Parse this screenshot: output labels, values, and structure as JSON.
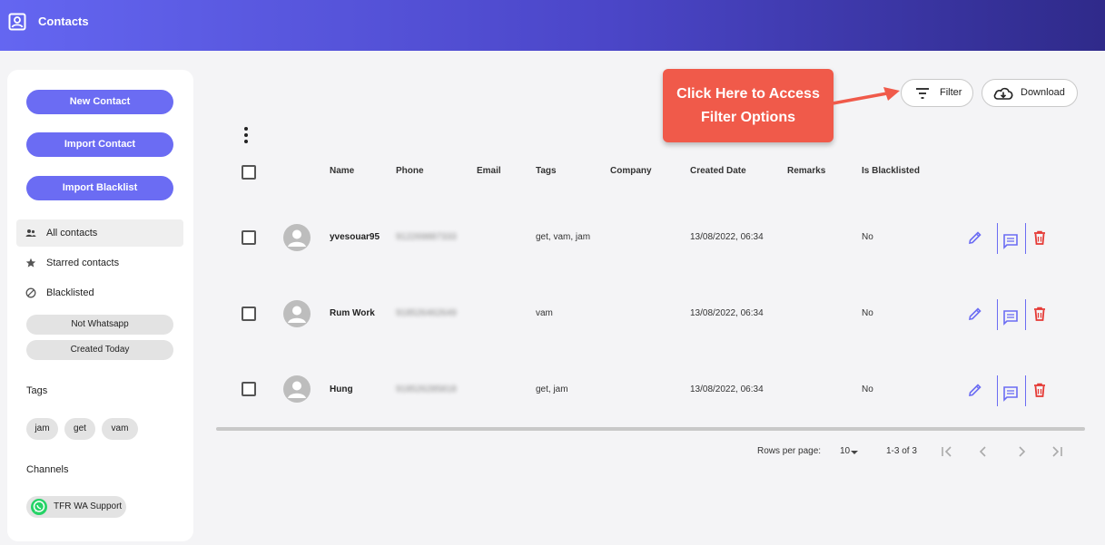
{
  "header": {
    "title": "Contacts"
  },
  "sidebar": {
    "buttons": [
      "New Contact",
      "Import Contact",
      "Import Blacklist"
    ],
    "nav": [
      {
        "label": "All contacts",
        "icon": "people-icon",
        "active": true
      },
      {
        "label": "Starred contacts",
        "icon": "star-icon",
        "active": false
      },
      {
        "label": "Blacklisted",
        "icon": "block-icon",
        "active": false
      }
    ],
    "filters": [
      "Not Whatsapp",
      "Created Today"
    ],
    "tags_title": "Tags",
    "tags": [
      "jam",
      "get",
      "vam"
    ],
    "channels_title": "Channels",
    "channel": {
      "label": "TFR WA Support",
      "icon": "whatsapp-icon"
    }
  },
  "toolbar": {
    "filter_label": "Filter",
    "download_label": "Download"
  },
  "callout": {
    "line1": "Click Here to Access",
    "line2": "Filter Options"
  },
  "table": {
    "columns": [
      "Name",
      "Phone",
      "Email",
      "Tags",
      "Company",
      "Created Date",
      "Remarks",
      "Is Blacklisted"
    ],
    "rows": [
      {
        "name": "yvesouar95",
        "phone": "912269887333",
        "email": "",
        "tags": "get, vam, jam",
        "company": "",
        "created": "13/08/2022, 06:34",
        "remarks": "",
        "blacklisted": "No"
      },
      {
        "name": "Rum Work",
        "phone": "918526462649",
        "email": "",
        "tags": "vam",
        "company": "",
        "created": "13/08/2022, 06:34",
        "remarks": "",
        "blacklisted": "No"
      },
      {
        "name": "Hung",
        "phone": "918526285818",
        "email": "",
        "tags": "get, jam",
        "company": "",
        "created": "13/08/2022, 06:34",
        "remarks": "",
        "blacklisted": "No"
      }
    ]
  },
  "pagination": {
    "rows_per_page_label": "Rows per page:",
    "rows_per_page": "10",
    "range": "1-3 of 3"
  },
  "colors": {
    "accent": "#6b6cf3",
    "header_start": "#6466f1",
    "header_end": "#2f2a8a",
    "callout": "#f05a4a",
    "delete": "#e53935"
  }
}
